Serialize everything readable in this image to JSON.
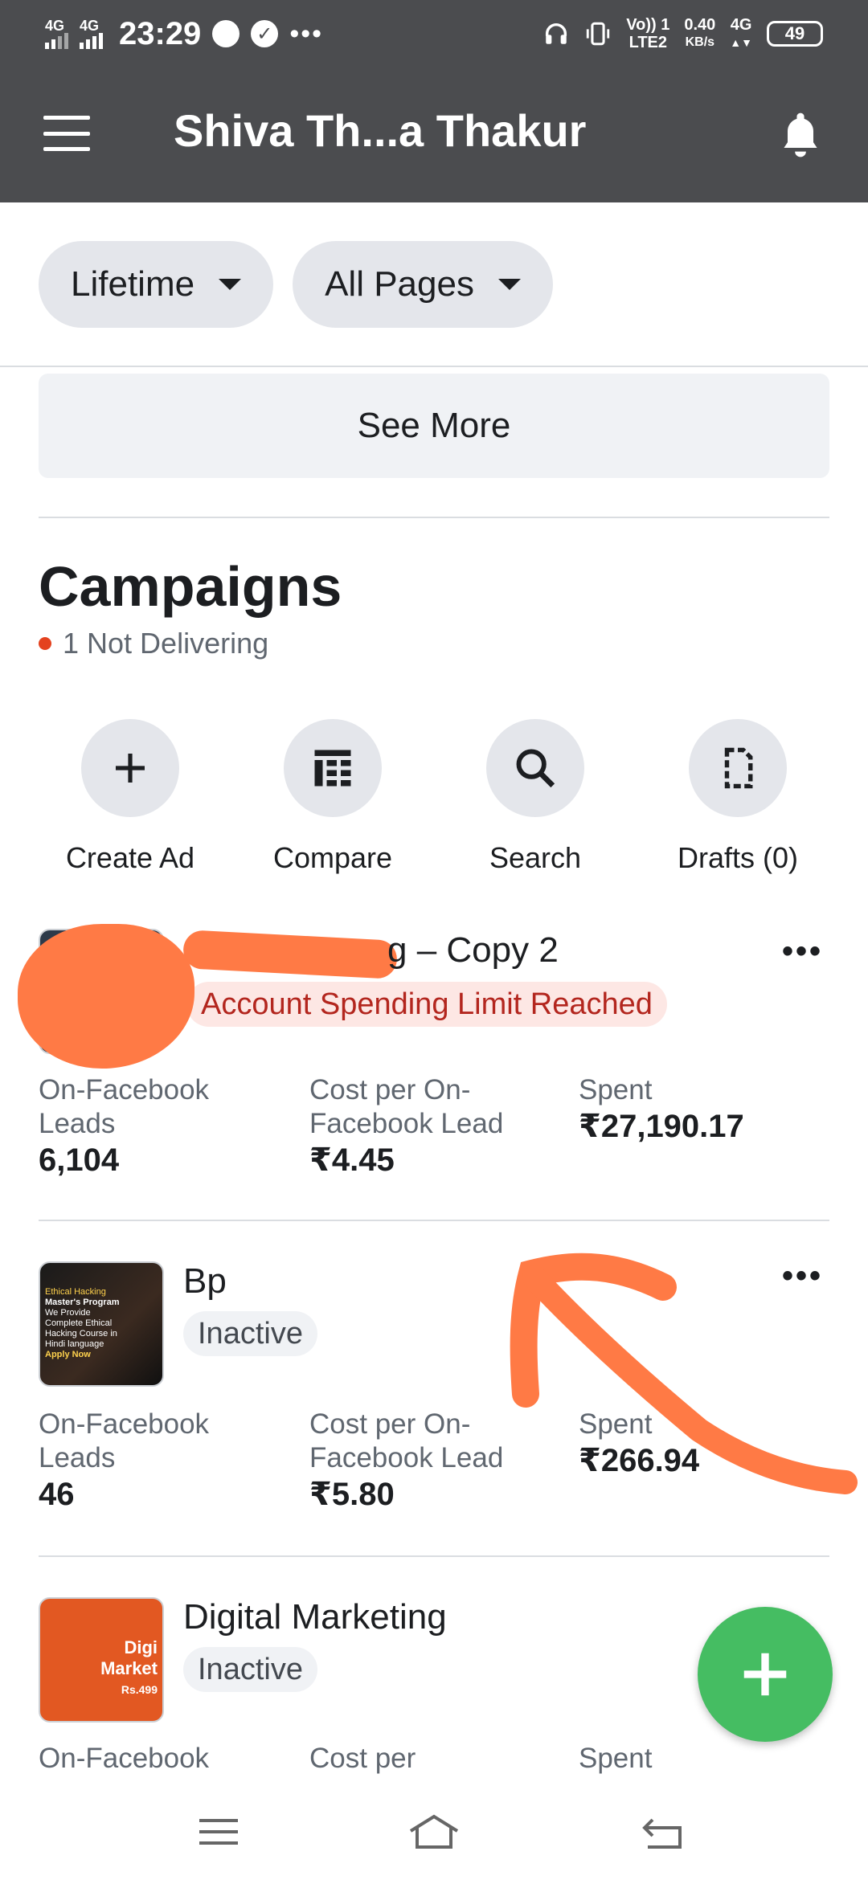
{
  "status_bar": {
    "sim1": "4G",
    "sim2": "4G",
    "time": "23:29",
    "volte": "Vo)) 1",
    "lte": "LTE2",
    "speed_value": "0.40",
    "speed_unit": "KB/s",
    "net": "4G",
    "battery": "49"
  },
  "header": {
    "title": "Shiva Th...a Thakur"
  },
  "filters": {
    "time_range": "Lifetime",
    "pages": "All Pages"
  },
  "see_more": "See More",
  "campaigns": {
    "title": "Campaigns",
    "status": "1 Not Delivering"
  },
  "actions": {
    "create_ad": "Create Ad",
    "compare": "Compare",
    "search": "Search",
    "drafts": "Drafts (0)"
  },
  "cards": [
    {
      "name_suffix": "g – Copy 2",
      "badge": "Account Spending Limit Reached",
      "metric1_label": "On-Facebook Leads",
      "metric1_value": "6,104",
      "metric2_label": "Cost per On-Facebook Lead",
      "metric2_value": "₹4.45",
      "metric3_label": "Spent",
      "metric3_value": "₹27,190.17"
    },
    {
      "name": "Bp",
      "badge": "Inactive",
      "metric1_label": "On-Facebook Leads",
      "metric1_value": "46",
      "metric2_label": "Cost per On-Facebook Lead",
      "metric2_value": "₹5.80",
      "metric3_label": "Spent",
      "metric3_value": "₹266.94",
      "thumb_lines": [
        "Ethical Hacking",
        "Master's Program",
        "We Provide",
        "Complete Ethical",
        "Hacking Course in",
        "Hindi language",
        "Apply Now"
      ]
    },
    {
      "name": "Digital Marketing",
      "badge": "Inactive",
      "metric1_label": "On-Facebook",
      "metric2_label": "Cost per",
      "metric3_label": "Spent",
      "thumb_lines": [
        "Digi",
        "Market",
        "Rs.499"
      ]
    }
  ],
  "colors": {
    "header_bg": "#4b4c4f",
    "pill_bg": "#e4e6eb",
    "limit_badge_bg": "#fde7e4",
    "limit_badge_text": "#b3261e",
    "fab": "#45bd62",
    "redaction": "#ff7a45"
  }
}
